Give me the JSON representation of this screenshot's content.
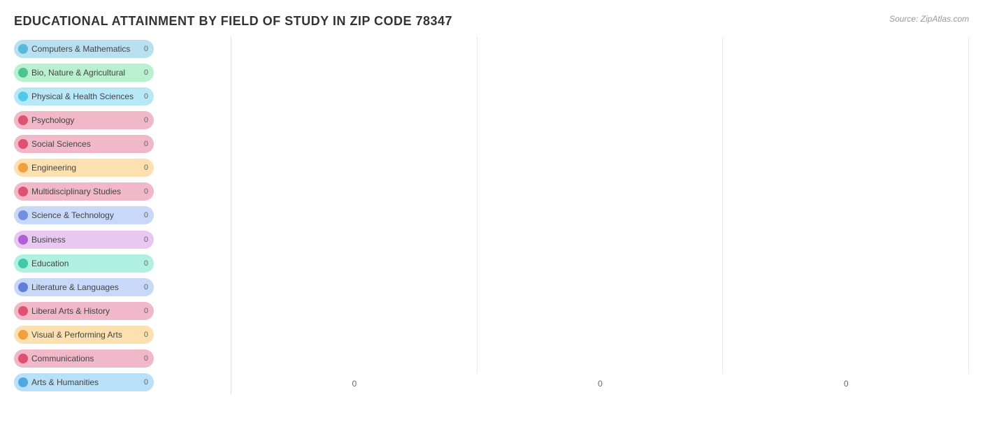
{
  "title": "EDUCATIONAL ATTAINMENT BY FIELD OF STUDY IN ZIP CODE 78347",
  "source": "Source: ZipAtlas.com",
  "categories": [
    {
      "label": "Computers & Mathematics",
      "value": 0,
      "colorClass": "cat-0"
    },
    {
      "label": "Bio, Nature & Agricultural",
      "value": 0,
      "colorClass": "cat-1"
    },
    {
      "label": "Physical & Health Sciences",
      "value": 0,
      "colorClass": "cat-2"
    },
    {
      "label": "Psychology",
      "value": 0,
      "colorClass": "cat-3"
    },
    {
      "label": "Social Sciences",
      "value": 0,
      "colorClass": "cat-4"
    },
    {
      "label": "Engineering",
      "value": 0,
      "colorClass": "cat-5"
    },
    {
      "label": "Multidisciplinary Studies",
      "value": 0,
      "colorClass": "cat-6"
    },
    {
      "label": "Science & Technology",
      "value": 0,
      "colorClass": "cat-7"
    },
    {
      "label": "Business",
      "value": 0,
      "colorClass": "cat-8"
    },
    {
      "label": "Education",
      "value": 0,
      "colorClass": "cat-9"
    },
    {
      "label": "Literature & Languages",
      "value": 0,
      "colorClass": "cat-10"
    },
    {
      "label": "Liberal Arts & History",
      "value": 0,
      "colorClass": "cat-11"
    },
    {
      "label": "Visual & Performing Arts",
      "value": 0,
      "colorClass": "cat-12"
    },
    {
      "label": "Communications",
      "value": 0,
      "colorClass": "cat-13"
    },
    {
      "label": "Arts & Humanities",
      "value": 0,
      "colorClass": "cat-14"
    }
  ],
  "x_axis_labels": [
    "0",
    "0",
    "0"
  ]
}
